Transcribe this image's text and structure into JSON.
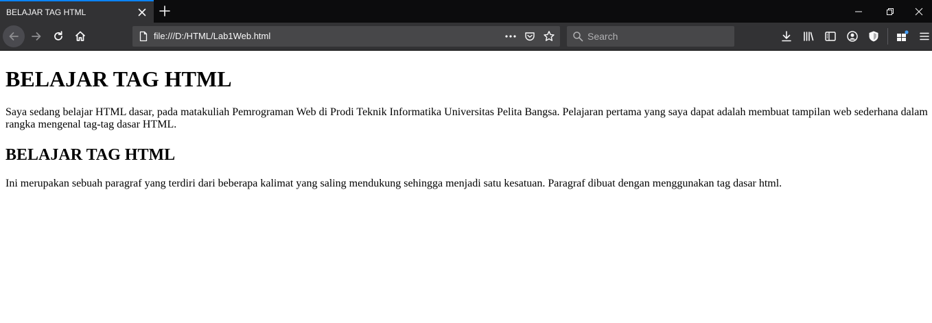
{
  "browser": {
    "tab": {
      "title": "BELAJAR TAG HTML"
    },
    "url": "file:///D:/HTML/Lab1Web.html",
    "search": {
      "placeholder": "Search"
    },
    "colors": {
      "tabbar": "#0c0c0d",
      "toolbar": "#323234",
      "urlbar": "#474749",
      "accent": "#0a84ff",
      "badge": "#45a1ff"
    },
    "icons": [
      "close-icon",
      "plus-icon",
      "minimize-icon",
      "restore-icon",
      "window-close-icon",
      "back-arrow-icon",
      "forward-arrow-icon",
      "reload-icon",
      "home-icon",
      "page-icon",
      "more-dots-icon",
      "pocket-icon",
      "star-icon",
      "search-icon",
      "download-icon",
      "library-icon",
      "sidebar-icon",
      "account-icon",
      "shield-icon",
      "extensions-icon",
      "hamburger-menu-icon"
    ]
  },
  "page": {
    "heading1": "BELAJAR TAG HTML",
    "paragraph1": "Saya sedang belajar HTML dasar, pada matakuliah Pemrograman Web di Prodi Teknik Informatika Universitas Pelita Bangsa. Pelajaran pertama yang saya dapat adalah membuat tampilan web sederhana dalam rangka mengenal tag-tag dasar HTML.",
    "heading2": "BELAJAR TAG HTML",
    "paragraph2": "Ini merupakan sebuah paragraf yang terdiri dari beberapa kalimat yang saling mendukung sehingga menjadi satu kesatuan. Paragraf dibuat dengan menggunakan tag dasar html."
  }
}
